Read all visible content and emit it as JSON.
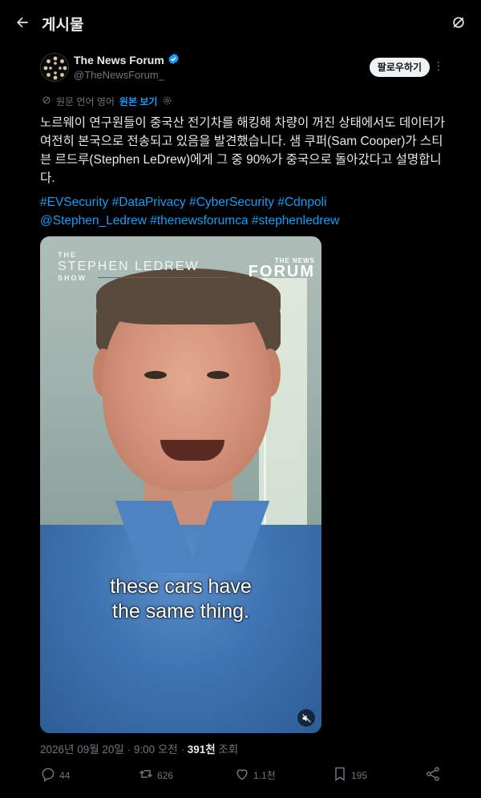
{
  "header": {
    "title": "게시물"
  },
  "author": {
    "name": "The News Forum",
    "handle": "@TheNewsForum_",
    "follow_label": "팔로우하기"
  },
  "translation": {
    "note": "원문 언어 영어",
    "show_original": "원본 보기"
  },
  "post": {
    "text": "노르웨이 연구원들이 중국산 전기차를 해킹해 차량이 꺼진 상태에서도 데이터가 여전히 본국으로 전송되고 있음을 발견했습니다. 샘 쿠퍼(Sam Cooper)가 스티븐 르드루(Stephen LeDrew)에게 그 중 90%가 중국으로 돌아갔다고 설명합니다.",
    "hashtags_line1": "#EVSecurity #DataPrivacy #CyberSecurity #Cdnpoli",
    "hashtags_line2": "@Stephen_Ledrew #thenewsforumca #stephenledrew"
  },
  "video": {
    "show_small": "THE",
    "show_name": "STEPHEN LEDREW",
    "show_suffix": "SHOW",
    "forum_small": "THE NEWS",
    "forum_big": "FORUM",
    "caption_line1": "these cars have",
    "caption_line2": "the same thing."
  },
  "meta": {
    "date": "2026년 09월 20일 · 9:00 오전 · ",
    "views": "391천",
    "views_label": " 조회"
  },
  "actions": {
    "replies": "44",
    "reposts": "626",
    "likes": "1.1천",
    "bookmarks": "195"
  }
}
